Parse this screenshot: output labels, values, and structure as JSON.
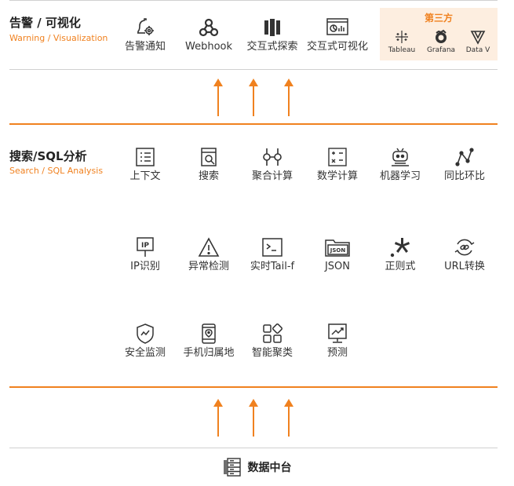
{
  "alert_section": {
    "title": "告警 / 可视化",
    "subtitle": "Warning / Visualization",
    "items": [
      {
        "label": "告警通知",
        "icon": "bell-gear-icon"
      },
      {
        "label": "Webhook",
        "icon": "webhook-icon"
      },
      {
        "label": "交互式探索",
        "icon": "explore-icon"
      },
      {
        "label": "交互式可视化",
        "icon": "dashboard-icon"
      }
    ],
    "third_party": {
      "title": "第三方",
      "items": [
        {
          "label": "Tableau",
          "icon": "tableau-icon"
        },
        {
          "label": "Grafana",
          "icon": "grafana-icon"
        },
        {
          "label": "Data V",
          "icon": "datav-icon"
        }
      ]
    }
  },
  "search_section": {
    "title": "搜索/SQL分析",
    "subtitle": "Search / SQL Analysis",
    "row1": [
      {
        "label": "上下文",
        "icon": "context-icon"
      },
      {
        "label": "搜索",
        "icon": "search-doc-icon"
      },
      {
        "label": "聚合计算",
        "icon": "aggregate-icon"
      },
      {
        "label": "数学计算",
        "icon": "calculator-icon"
      },
      {
        "label": "机器学习",
        "icon": "robot-icon"
      },
      {
        "label": "同比环比",
        "icon": "trend-line-icon"
      }
    ],
    "row2": [
      {
        "label": "IP识别",
        "icon": "ip-pin-icon"
      },
      {
        "label": "异常检测",
        "icon": "warning-icon"
      },
      {
        "label": "实时Tail-f",
        "icon": "terminal-icon"
      },
      {
        "label": "JSON",
        "icon": "json-folder-icon"
      },
      {
        "label": "正则式",
        "icon": "regex-icon"
      },
      {
        "label": "URL转换",
        "icon": "url-link-icon"
      }
    ],
    "row3": [
      {
        "label": "安全监测",
        "icon": "shield-icon"
      },
      {
        "label": "手机归属地",
        "icon": "phone-location-icon"
      },
      {
        "label": "智能聚类",
        "icon": "cluster-icon"
      },
      {
        "label": "预测",
        "icon": "forecast-icon"
      }
    ]
  },
  "data_platform": {
    "label": "数据中台",
    "icon": "server-rack-icon"
  },
  "colors": {
    "accent": "#f0811f",
    "third_party_bg": "#fdeee0",
    "divider": "#d0d0d0",
    "text": "#333333"
  }
}
